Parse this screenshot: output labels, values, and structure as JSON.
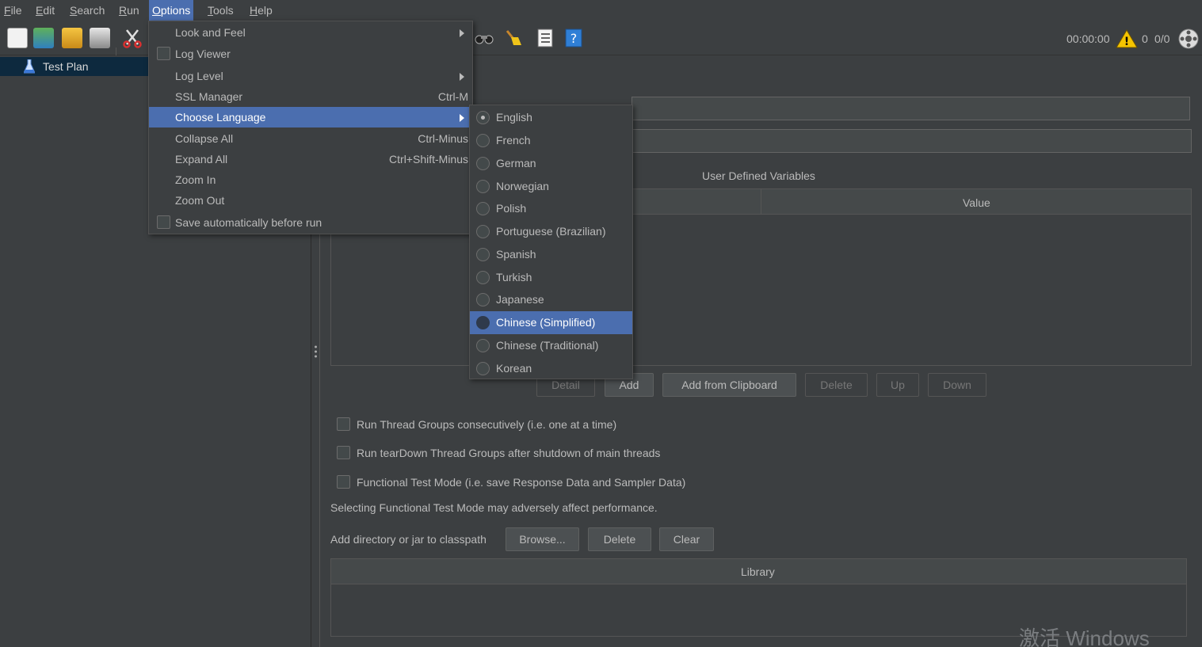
{
  "menubar": [
    {
      "label": "File",
      "u": "F",
      "rest": "ile"
    },
    {
      "label": "Edit",
      "u": "E",
      "rest": "dit"
    },
    {
      "label": "Search",
      "u": "S",
      "rest": "earch"
    },
    {
      "label": "Run",
      "u": "R",
      "rest": "un"
    },
    {
      "label": "Options",
      "u": "O",
      "rest": "ptions"
    },
    {
      "label": "Tools",
      "u": "T",
      "rest": "ools"
    },
    {
      "label": "Help",
      "u": "H",
      "rest": "elp"
    }
  ],
  "toolbar": {
    "timer": "00:00:00",
    "warning_count": "0",
    "threads": "0/0"
  },
  "tree": {
    "item": "Test Plan"
  },
  "options_menu": [
    {
      "label": "Look and Feel",
      "accel": "",
      "submenu": true,
      "checkbox": false
    },
    {
      "label": "Log Viewer",
      "accel": "",
      "submenu": false,
      "checkbox": true
    },
    {
      "label": "Log Level",
      "accel": "",
      "submenu": true,
      "checkbox": false
    },
    {
      "label": "SSL Manager",
      "accel": "Ctrl-M",
      "submenu": false,
      "checkbox": false
    },
    {
      "label": "Choose Language",
      "accel": "",
      "submenu": true,
      "checkbox": false,
      "selected": true
    },
    {
      "label": "Collapse All",
      "accel": "Ctrl-Minus",
      "submenu": false,
      "checkbox": false
    },
    {
      "label": "Expand All",
      "accel": "Ctrl+Shift-Minus",
      "submenu": false,
      "checkbox": false
    },
    {
      "label": "Zoom In",
      "accel": "",
      "submenu": false,
      "checkbox": false
    },
    {
      "label": "Zoom Out",
      "accel": "",
      "submenu": false,
      "checkbox": false
    },
    {
      "label": "Save automatically before run",
      "accel": "",
      "submenu": false,
      "checkbox": true
    }
  ],
  "language_menu": [
    {
      "label": "English",
      "checked": true
    },
    {
      "label": "French"
    },
    {
      "label": "German"
    },
    {
      "label": "Norwegian"
    },
    {
      "label": "Polish"
    },
    {
      "label": "Portuguese (Brazilian)"
    },
    {
      "label": "Spanish"
    },
    {
      "label": "Turkish"
    },
    {
      "label": "Japanese"
    },
    {
      "label": "Chinese (Simplified)",
      "selected": true
    },
    {
      "label": "Chinese (Traditional)"
    },
    {
      "label": "Korean"
    }
  ],
  "main": {
    "udv_title": "User Defined Variables",
    "udv_col_value": "Value",
    "buttons": {
      "detail": "Detail",
      "add": "Add",
      "add_clipboard": "Add from Clipboard",
      "delete": "Delete",
      "up": "Up",
      "down": "Down"
    },
    "checks": {
      "consecutive": "Run Thread Groups consecutively (i.e. one at a time)",
      "teardown": "Run tearDown Thread Groups after shutdown of main threads",
      "functional": "Functional Test Mode (i.e. save Response Data and Sampler Data)"
    },
    "functional_note": "Selecting Functional Test Mode may adversely affect performance.",
    "classpath_label": "Add directory or jar to classpath",
    "cp_buttons": {
      "browse": "Browse...",
      "delete": "Delete",
      "clear": "Clear"
    },
    "library_header": "Library"
  },
  "watermark": "激活 Windows"
}
